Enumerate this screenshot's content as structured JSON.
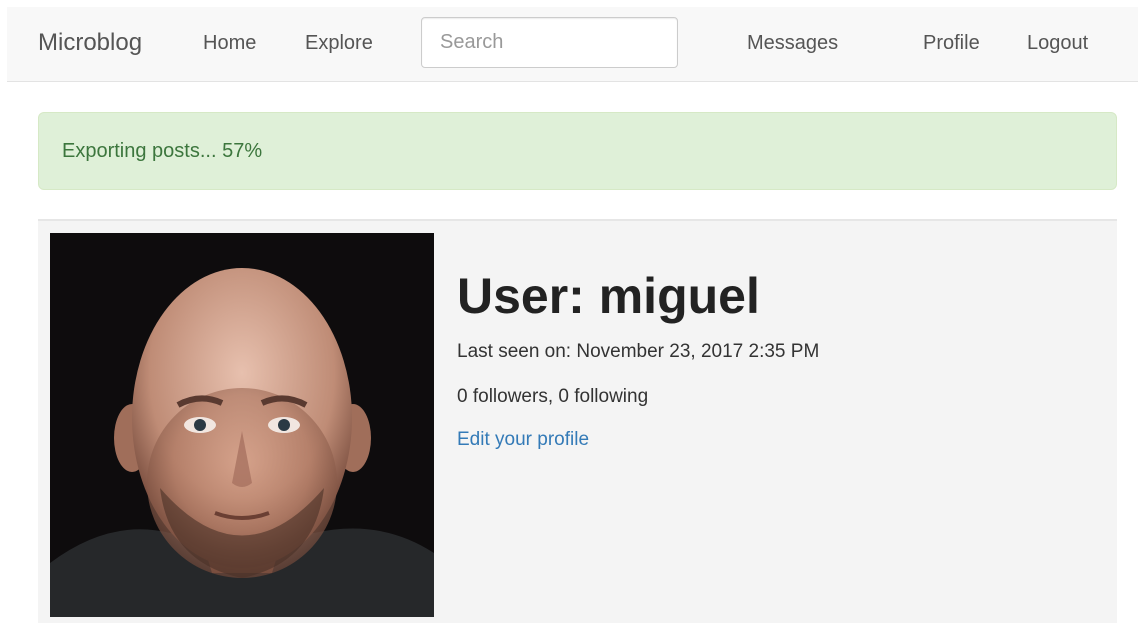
{
  "navbar": {
    "brand": "Microblog",
    "home": "Home",
    "explore": "Explore",
    "search_placeholder": "Search",
    "messages": "Messages",
    "profile": "Profile",
    "logout": "Logout"
  },
  "alert": {
    "message": "Exporting posts... 57%",
    "progress_percent": 57
  },
  "profile": {
    "heading": "User: miguel",
    "last_seen": "Last seen on: November 23, 2017 2:35 PM",
    "follow_counts": "0 followers, 0 following",
    "edit_link": "Edit your profile"
  },
  "colors": {
    "link": "#337ab7",
    "alert_bg": "#dff0d8",
    "alert_text": "#3c763d",
    "navbar_bg": "#f8f8f8"
  }
}
